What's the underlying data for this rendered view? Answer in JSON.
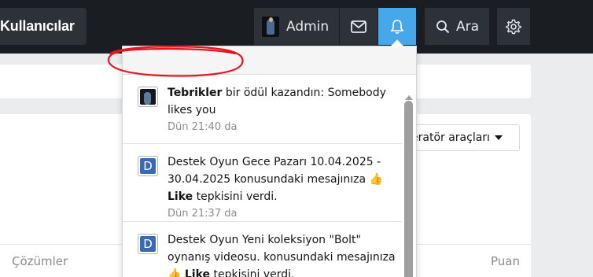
{
  "nav": {
    "users_label": "Kullanıcılar",
    "admin_label": "Admin",
    "search_label": "Ara"
  },
  "page": {
    "mod_tools_label": "eratör araçları",
    "col_solutions": "Çözümler",
    "col_points": "Puan"
  },
  "notifications": [
    {
      "avatar_letter": "",
      "strong": "Tebrikler",
      "text": " bir ödül kazandın: Somebody likes you",
      "time": "Dün 21:40 da"
    },
    {
      "avatar_letter": "D",
      "text_a": "Destek Oyun Gece Pazarı 10.04.2025 - 30.04.2025 konusundaki mesajınıza",
      "emoji": "👍",
      "strong": "Like",
      "text_b": " tepkisini verdi.",
      "time": "Dün 21:37 da"
    },
    {
      "avatar_letter": "D",
      "text_a": "Destek Oyun Yeni koleksiyon \"Bolt\" oynanış videosu. konusundaki mesajınıza",
      "emoji": "👍",
      "strong": "Like",
      "text_b": " tepkisini verdi."
    }
  ],
  "colors": {
    "nav_bg": "#1a1e23",
    "nav_item_bg": "#2d3238",
    "bell_active": "#47a7eb",
    "scribble": "#e8141c"
  }
}
